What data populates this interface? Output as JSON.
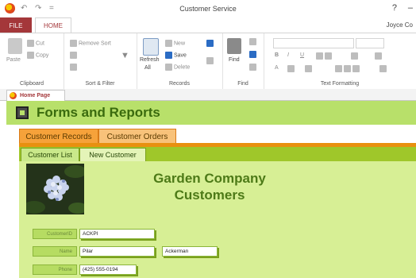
{
  "window": {
    "title": "Customer Service",
    "user": "Joyce Co",
    "help_glyph": "?",
    "minimize_glyph": "–"
  },
  "qat": {
    "undo_glyph": "↶",
    "redo_glyph": "↷",
    "customize_glyph": "="
  },
  "ribbon_tabs": {
    "file": "FILE",
    "home": "HOME"
  },
  "ribbon": {
    "clipboard": {
      "label": "Clipboard",
      "paste": "Paste",
      "cut": "Cut",
      "copy": "Copy"
    },
    "sort_filter": {
      "label": "Sort & Filter",
      "remove_sort": "Remove Sort"
    },
    "records": {
      "label": "Records",
      "refresh": "Refresh",
      "refresh_all": "All",
      "new": "New",
      "save": "Save",
      "delete": "Delete"
    },
    "find": {
      "label": "Find",
      "find": "Find"
    },
    "text_formatting": {
      "label": "Text Formatting",
      "bold": "B",
      "italic": "I",
      "underline": "U",
      "font_color": "A"
    }
  },
  "nav_tabs": {
    "home_page": "Home Page"
  },
  "form": {
    "title": "Forms and Reports",
    "outer_tabs": [
      "Customer Records",
      "Customer Orders"
    ],
    "active_outer_tab": "Customer Orders",
    "inner_tabs": [
      "Customer List",
      "New Customer"
    ],
    "active_inner_tab": "New Customer",
    "company_title_line1": "Garden Company",
    "company_title_line2": "Customers",
    "fields": {
      "customer_id": {
        "label": "CustomerID",
        "value": "ACKPI"
      },
      "name": {
        "label": "Name",
        "first": "Pilar",
        "last": "Ackerman"
      },
      "phone": {
        "label": "Phone",
        "value": "(425) 555-0194"
      }
    }
  },
  "colors": {
    "file_tab": "#a4373a",
    "header_band": "#b8e06a",
    "title_green": "#3a6b0e",
    "outer_tab_orange": "#f6a23a",
    "inner_area_green": "#9fc72a",
    "inner_body_green": "#d7ef95"
  }
}
